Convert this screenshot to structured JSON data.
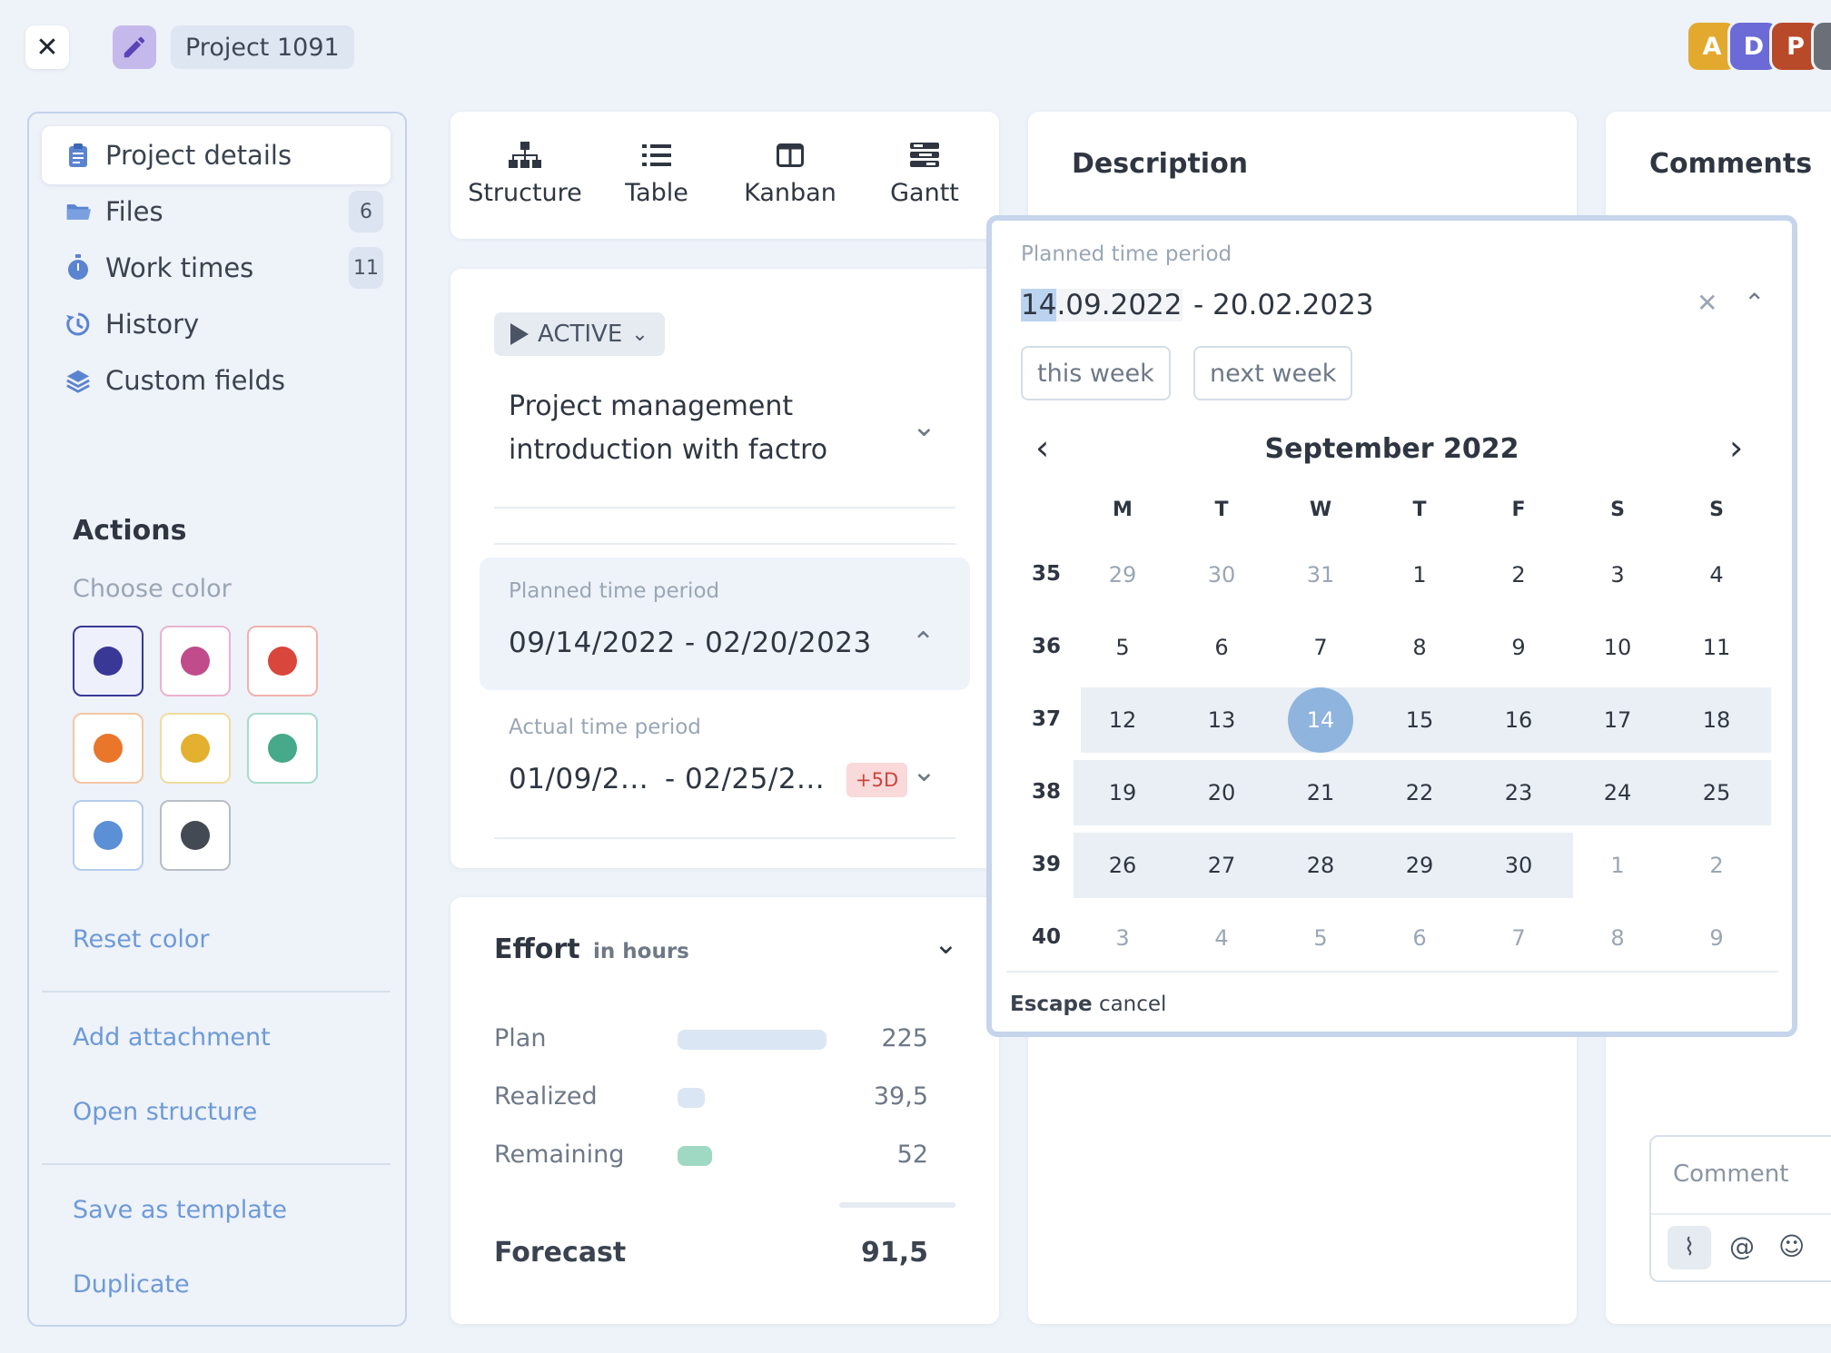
{
  "header": {
    "project_name": "Project 1091",
    "avatars": [
      {
        "letter": "A",
        "color": "#e3a92e"
      },
      {
        "letter": "D",
        "color": "#6b6ad6"
      },
      {
        "letter": "P",
        "color": "#b84a2a"
      }
    ]
  },
  "sidebar": {
    "items": [
      {
        "label": "Project details",
        "icon": "clipboard-icon",
        "active": true
      },
      {
        "label": "Files",
        "icon": "folder-icon",
        "badge": "6"
      },
      {
        "label": "Work times",
        "icon": "stopwatch-icon",
        "badge": "11"
      },
      {
        "label": "History",
        "icon": "history-icon"
      },
      {
        "label": "Custom fields",
        "icon": "layers-icon"
      }
    ],
    "actions_title": "Actions",
    "choose_color": "Choose color",
    "colors": [
      "#3a3896",
      "#c04c8c",
      "#d9463c",
      "#e9762a",
      "#e3b02f",
      "#45a98a",
      "#5b8fd6",
      "#444a54"
    ],
    "reset_color": "Reset color",
    "add_attachment": "Add attachment",
    "open_structure": "Open structure",
    "save_as_template": "Save as template",
    "duplicate": "Duplicate"
  },
  "views": {
    "tabs": [
      {
        "label": "Structure",
        "icon": "structure-icon"
      },
      {
        "label": "Table",
        "icon": "list-icon"
      },
      {
        "label": "Kanban",
        "icon": "kanban-icon"
      },
      {
        "label": "Gantt",
        "icon": "gantt-icon"
      }
    ]
  },
  "details": {
    "status": "ACTIVE",
    "title": "Project management introduction with factro",
    "planned_label": "Planned time period",
    "planned_value": "09/14/2022 - 02/20/2023",
    "actual_label": "Actual time period",
    "actual_start": "01/09/2...",
    "actual_end": "- 02/25/2...",
    "actual_badge": "+5D"
  },
  "effort": {
    "title": "Effort",
    "unit": "in hours",
    "rows": [
      {
        "label": "Plan",
        "value": "225",
        "color": "#dae6f3"
      },
      {
        "label": "Realized",
        "value": "39,5",
        "color": "#dae6f3"
      },
      {
        "label": "Remaining",
        "value": "52",
        "color": "#9fd9c3"
      }
    ],
    "forecast_label": "Forecast",
    "forecast_value": "91,5"
  },
  "description": {
    "title": "Description"
  },
  "comments": {
    "title": "Comments",
    "placeholder": "Comment"
  },
  "picker": {
    "label": "Planned time period",
    "start_highlight": "14",
    "start_rest": ".09.2022",
    "end": "- 20.02.2023",
    "quick": [
      "this week",
      "next week"
    ],
    "month": "September 2022",
    "weekdays": [
      "M",
      "T",
      "W",
      "T",
      "F",
      "S",
      "S"
    ],
    "weeks": [
      {
        "num": "35",
        "days": [
          "29",
          "30",
          "31",
          "1",
          "2",
          "3",
          "4"
        ]
      },
      {
        "num": "36",
        "days": [
          "5",
          "6",
          "7",
          "8",
          "9",
          "10",
          "11"
        ]
      },
      {
        "num": "37",
        "days": [
          "12",
          "13",
          "14",
          "15",
          "16",
          "17",
          "18"
        ]
      },
      {
        "num": "38",
        "days": [
          "19",
          "20",
          "21",
          "22",
          "23",
          "24",
          "25"
        ]
      },
      {
        "num": "39",
        "days": [
          "26",
          "27",
          "28",
          "29",
          "30",
          "1",
          "2"
        ]
      },
      {
        "num": "40",
        "days": [
          "3",
          "4",
          "5",
          "6",
          "7",
          "8",
          "9"
        ]
      }
    ],
    "escape_key": "Escape",
    "escape_text": "cancel"
  }
}
